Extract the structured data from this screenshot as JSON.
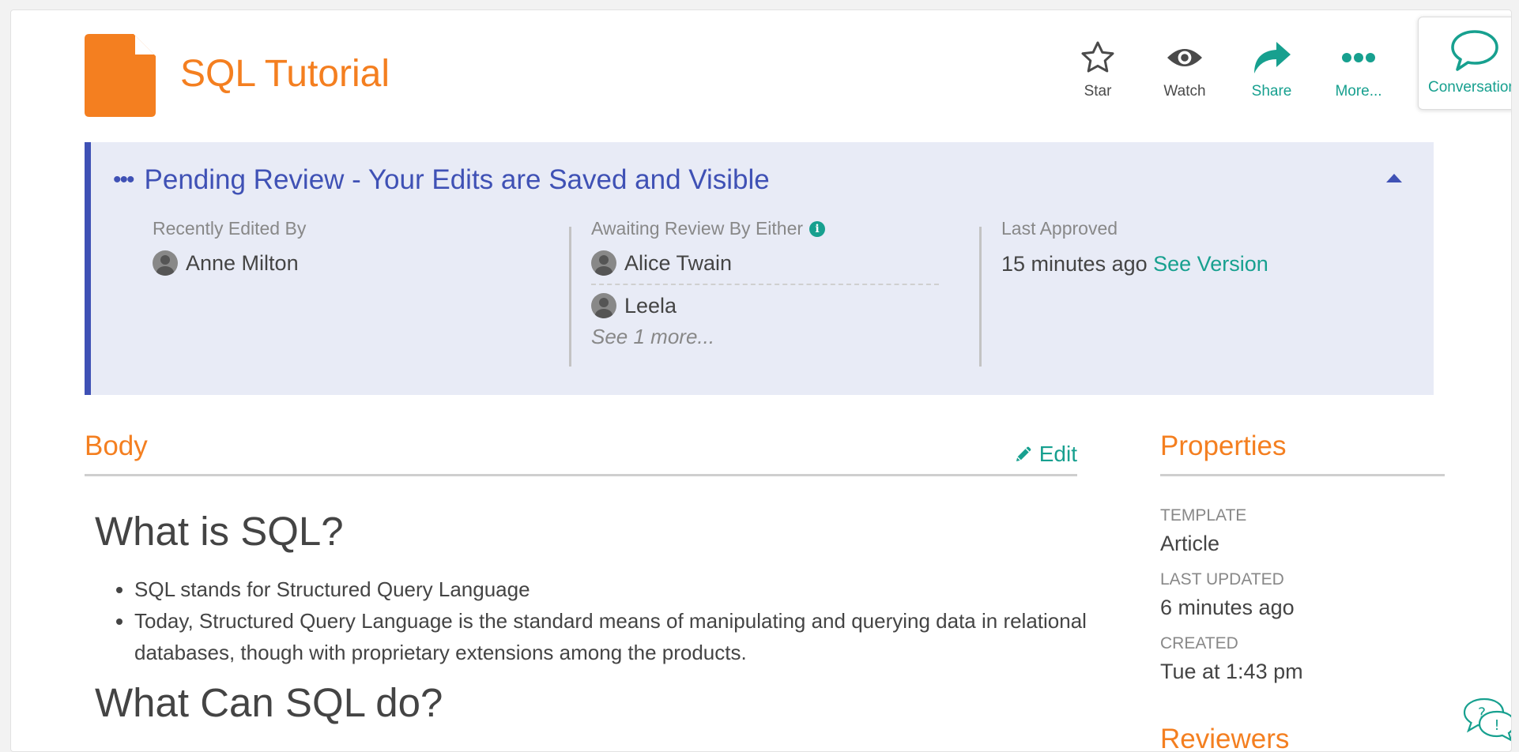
{
  "header": {
    "title": "SQL Tutorial",
    "actions": [
      {
        "label": "Star",
        "icon": "star-icon"
      },
      {
        "label": "Watch",
        "icon": "eye-icon"
      },
      {
        "label": "Share",
        "icon": "share-icon"
      },
      {
        "label": "More...",
        "icon": "more-dots-icon"
      }
    ],
    "conversations_label": "Conversations"
  },
  "review_banner": {
    "title": "Pending Review - Your Edits are Saved and Visible",
    "recently_edited_label": "Recently Edited By",
    "recently_edited_by": "Anne Milton",
    "awaiting_label": "Awaiting Review By Either",
    "reviewers": [
      "Alice Twain",
      "Leela"
    ],
    "see_more": "See 1 more...",
    "last_approved_label": "Last Approved",
    "last_approved_time": "15 minutes ago",
    "see_version": "See Version"
  },
  "body": {
    "section_title": "Body",
    "edit_label": "Edit",
    "heading1": "What is SQL?",
    "bullets": [
      "SQL stands for Structured Query Language",
      "Today, Structured Query Language is the standard means of manipulating and querying data in relational databases, though with proprietary extensions among the products."
    ],
    "heading2": "What Can SQL do?"
  },
  "properties": {
    "section_title": "Properties",
    "items": [
      {
        "label": "TEMPLATE",
        "value": "Article"
      },
      {
        "label": "LAST UPDATED",
        "value": "6 minutes ago"
      },
      {
        "label": "CREATED",
        "value": "Tue at 1:43 pm"
      }
    ],
    "reviewers_title": "Reviewers"
  },
  "colors": {
    "accent_orange": "#f47f20",
    "accent_teal": "#17a08f",
    "banner_blue": "#3f51b5",
    "banner_bg": "#e8ebf6"
  }
}
